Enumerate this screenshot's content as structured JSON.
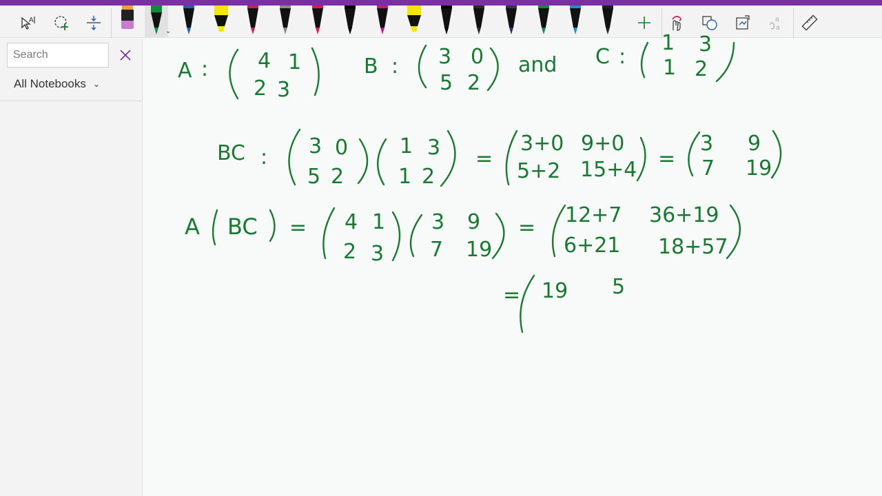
{
  "app": {
    "accent": "#7a2fa3",
    "ink_color": "#187a31"
  },
  "toolbar": {
    "tools": [
      {
        "icon": "lasso-select-text-icon"
      },
      {
        "icon": "lasso-select-icon"
      },
      {
        "icon": "insert-space-icon"
      },
      {
        "icon": "eraser-icon"
      }
    ],
    "pens": [
      {
        "type": "pen",
        "color": "#000000"
      },
      {
        "type": "pen",
        "color": "#1f5fb8"
      },
      {
        "type": "highlighter",
        "color": "#f5e600"
      },
      {
        "type": "pen",
        "color": "#c21f5f"
      },
      {
        "type": "pen",
        "color": "#8a8a8a"
      },
      {
        "type": "pen",
        "color": "#e5115a"
      },
      {
        "type": "pen",
        "color": "#000000"
      },
      {
        "type": "pen",
        "color": "#c2188a"
      },
      {
        "type": "highlighter",
        "color": "#f5e600"
      },
      {
        "type": "pen",
        "color": "#000000"
      },
      {
        "type": "pen",
        "color": "#2b2b2b"
      },
      {
        "type": "pen",
        "color": "#3d2b6b"
      },
      {
        "type": "pen",
        "color": "#0f8a3a"
      },
      {
        "type": "pen",
        "color": "#1a8fd8"
      },
      {
        "type": "pen",
        "color": "#1a1a3a"
      }
    ],
    "actions": [
      {
        "icon": "add-pen-icon"
      },
      {
        "icon": "touch-drawing-icon"
      },
      {
        "icon": "ink-to-shape-icon"
      },
      {
        "icon": "ink-to-text-icon"
      },
      {
        "icon": "ink-to-math-icon"
      },
      {
        "icon": "ruler-icon"
      }
    ]
  },
  "sidebar": {
    "search": {
      "placeholder": "Search",
      "value": ""
    },
    "notebook_select": "All Notebooks"
  },
  "handwriting": {
    "line1": {
      "A_label": "A",
      "eq": ":",
      "A_row1": [
        "4",
        "1"
      ],
      "A_row2": [
        "2",
        "3"
      ],
      "B_label": "B",
      "B_row1": [
        "3",
        "0"
      ],
      "B_row2": [
        "5",
        "2"
      ],
      "and": "and",
      "C_label": "C",
      "C_row1": [
        "1",
        "3"
      ],
      "C_row2": [
        "1",
        "2"
      ]
    },
    "line2": {
      "label": "BC",
      "eq": ":",
      "m1_row1": [
        "3",
        "0"
      ],
      "m1_row2": [
        "5",
        "2"
      ],
      "m2_row1": [
        "1",
        "3"
      ],
      "m2_row2": [
        "1",
        "2"
      ],
      "eq2": "=",
      "r_row1": [
        "3+0",
        "9+0"
      ],
      "r_row2": [
        "5+2",
        "15+4"
      ],
      "eq3": "=",
      "f_row1": [
        "3",
        "9"
      ],
      "f_row2": [
        "7",
        "19"
      ]
    },
    "line3": {
      "label": "A(BC)",
      "eq": "=",
      "m1_row1": [
        "4",
        "1"
      ],
      "m1_row2": [
        "2",
        "3"
      ],
      "m2_row1": [
        "3",
        "9"
      ],
      "m2_row2": [
        "7",
        "19"
      ],
      "eq2": "=",
      "r_row1": [
        "12+7",
        "36+19"
      ],
      "r_row2": [
        "6+21",
        "18+57"
      ]
    },
    "line4": {
      "eq": "=",
      "row1": [
        "19",
        "5"
      ]
    }
  }
}
